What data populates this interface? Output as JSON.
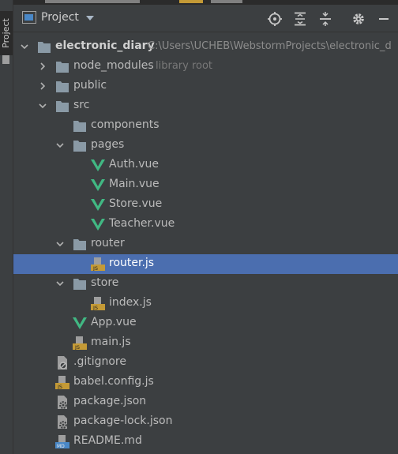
{
  "side": {
    "tab_label": "Project"
  },
  "header": {
    "title": "Project"
  },
  "colors": {
    "background": "#3c3f41",
    "selection": "#4b6eaf",
    "vue": "#41b883",
    "js_badge": "#c49a36",
    "folder": "#8a9aa6"
  },
  "tree": {
    "root": {
      "label": "electronic_diary",
      "path": "C:\\Users\\UCHEB\\WebstormProjects\\electronic_d"
    },
    "node_modules": {
      "label": "node_modules",
      "hint": "library root"
    },
    "public": {
      "label": "public"
    },
    "src": {
      "label": "src"
    },
    "components": {
      "label": "components"
    },
    "pages": {
      "label": "pages"
    },
    "auth_vue": {
      "label": "Auth.vue"
    },
    "main_vue": {
      "label": "Main.vue"
    },
    "store_vue": {
      "label": "Store.vue"
    },
    "teacher_vue": {
      "label": "Teacher.vue"
    },
    "router": {
      "label": "router"
    },
    "router_js": {
      "label": "router.js"
    },
    "store": {
      "label": "store"
    },
    "index_js": {
      "label": "index.js"
    },
    "app_vue": {
      "label": "App.vue"
    },
    "main_js": {
      "label": "main.js"
    },
    "gitignore": {
      "label": ".gitignore"
    },
    "babel_config": {
      "label": "babel.config.js"
    },
    "package_json": {
      "label": "package.json"
    },
    "package_lock": {
      "label": "package-lock.json"
    },
    "readme": {
      "label": "README.md"
    }
  }
}
